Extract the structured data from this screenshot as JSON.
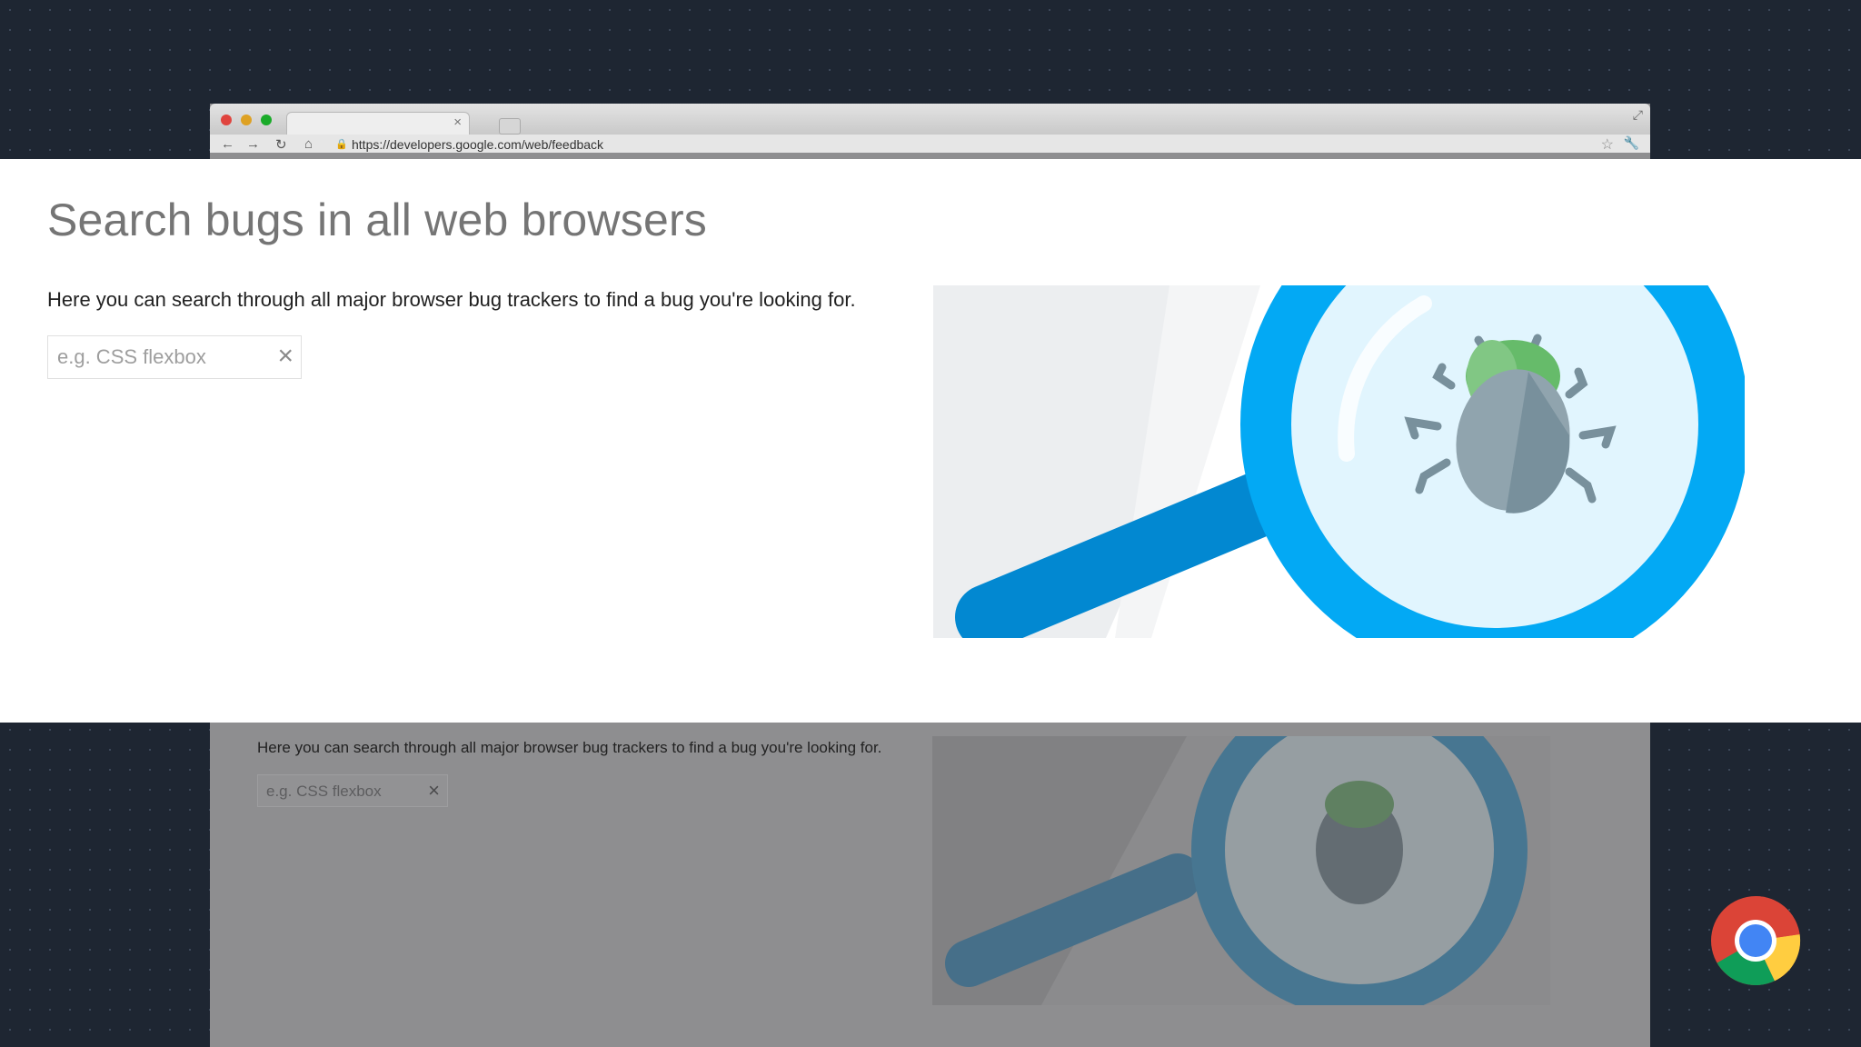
{
  "browser": {
    "url": "https://developers.google.com/web/feedback",
    "tab_close": "×"
  },
  "page": {
    "title": "Search bugs in all web browsers",
    "description": "Here you can search through all major browser bug trackers to find a bug you're looking for.",
    "search": {
      "placeholder": "e.g. CSS flexbox",
      "value": "",
      "clear_label": "×"
    }
  },
  "icons": {
    "back": "back-arrow-icon",
    "forward": "forward-arrow-icon",
    "reload": "reload-icon",
    "home": "home-icon",
    "star": "bookmark-star-icon",
    "wrench": "wrench-icon",
    "illustration": "magnifying-glass-bug-illustration",
    "logo": "chrome-logo"
  },
  "colors": {
    "background": "#1e2632",
    "magnifier_blue": "#03a9f4",
    "handle_blue": "#0288d1",
    "lens": "#e1f5fe",
    "bug_body": "#90a4ae",
    "bug_head": "#66bb6a"
  }
}
